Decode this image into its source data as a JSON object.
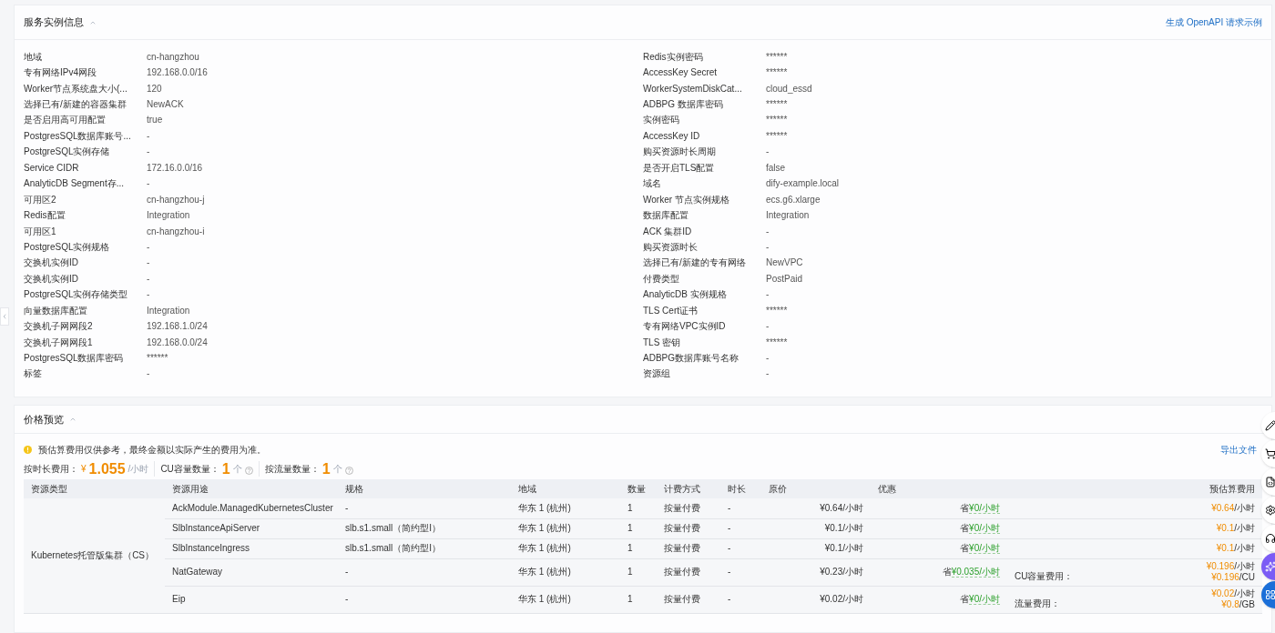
{
  "instance_section": {
    "title": "服务实例信息",
    "expanded": true,
    "link": "生成 OpenAPI 请求示例",
    "left_fields": [
      {
        "label": "地域",
        "value": "cn-hangzhou"
      },
      {
        "label": "专有网络IPv4网段",
        "value": "192.168.0.0/16"
      },
      {
        "label": "Worker节点系统盘大小(...",
        "value": "120"
      },
      {
        "label": "选择已有/新建的容器集群",
        "value": "NewACK"
      },
      {
        "label": "是否启用高可用配置",
        "value": "true"
      },
      {
        "label": "PostgresSQL数据库账号...",
        "value": "-"
      },
      {
        "label": "PostgreSQL实例存储",
        "value": "-"
      },
      {
        "label": "Service CIDR",
        "value": "172.16.0.0/16"
      },
      {
        "label": "AnalyticDB Segment存...",
        "value": "-"
      },
      {
        "label": "可用区2",
        "value": "cn-hangzhou-j"
      },
      {
        "label": "Redis配置",
        "value": "Integration"
      },
      {
        "label": "可用区1",
        "value": "cn-hangzhou-i"
      },
      {
        "label": "PostgreSQL实例规格",
        "value": "-"
      },
      {
        "label": "交换机实例ID",
        "value": "-"
      },
      {
        "label": "交换机实例ID",
        "value": "-"
      },
      {
        "label": "PostgreSQL实例存储类型",
        "value": "-"
      },
      {
        "label": "向量数据库配置",
        "value": "Integration"
      },
      {
        "label": "交换机子网网段2",
        "value": "192.168.1.0/24"
      },
      {
        "label": "交换机子网网段1",
        "value": "192.168.0.0/24"
      },
      {
        "label": "PostgresSQL数据库密码",
        "value": "******"
      },
      {
        "label": "标签",
        "value": "-"
      }
    ],
    "right_fields": [
      {
        "label": "Redis实例密码",
        "value": "******"
      },
      {
        "label": "AccessKey Secret",
        "value": "******"
      },
      {
        "label": "WorkerSystemDiskCat...",
        "value": "cloud_essd"
      },
      {
        "label": "ADBPG 数据库密码",
        "value": "******"
      },
      {
        "label": "实例密码",
        "value": "******"
      },
      {
        "label": "AccessKey ID",
        "value": "******"
      },
      {
        "label": "购买资源时长周期",
        "value": "-"
      },
      {
        "label": "是否开启TLS配置",
        "value": "false"
      },
      {
        "label": "域名",
        "value": "dify-example.local"
      },
      {
        "label": "Worker 节点实例规格",
        "value": "ecs.g6.xlarge"
      },
      {
        "label": "数据库配置",
        "value": "Integration"
      },
      {
        "label": "ACK 集群ID",
        "value": "-"
      },
      {
        "label": "购买资源时长",
        "value": "-"
      },
      {
        "label": "选择已有/新建的专有网络",
        "value": "NewVPC"
      },
      {
        "label": "付费类型",
        "value": "PostPaid"
      },
      {
        "label": "AnalyticDB 实例规格",
        "value": "-"
      },
      {
        "label": "TLS Cert证书",
        "value": "******"
      },
      {
        "label": "专有网络VPC实例ID",
        "value": "-"
      },
      {
        "label": "TLS 密钥",
        "value": "******"
      },
      {
        "label": "ADBPG数据库账号名称",
        "value": "-"
      },
      {
        "label": "资源组",
        "value": "-"
      }
    ]
  },
  "price_section": {
    "title": "价格预览",
    "expanded": true,
    "notice": "预估算费用仅供参考，最终金额以实际产生的费用为准。",
    "export_link": "导出文件",
    "summary": [
      {
        "label": "按时长费用：",
        "currency": "¥",
        "amount": "1.055",
        "unit": "/小时",
        "help": false
      },
      {
        "label": "CU容量数量：",
        "amount": "1",
        "unit": "个",
        "help": true
      },
      {
        "label": "按流量数量：",
        "amount": "1",
        "unit": "个",
        "help": true
      }
    ],
    "columns": [
      "资源类型",
      "资源用途",
      "规格",
      "地域",
      "数量",
      "计费方式",
      "时长",
      "原价",
      "优惠",
      "预估算费用"
    ],
    "resource_type": "Kubernetes托管版集群（CS）",
    "rows": [
      {
        "usage": "AckModule.ManagedKubernetesCluster",
        "spec": "-",
        "region": "华东 1 (杭州)",
        "quantity": "1",
        "billing": "按量付费",
        "duration": "-",
        "price": "¥0.64/小时",
        "discount_prefix": "省",
        "discount": "¥0/小时",
        "extra": "",
        "estimate": [
          {
            "amount": "¥0.64",
            "unit": "/小时"
          }
        ]
      },
      {
        "usage": "SlbInstanceApiServer",
        "spec": "slb.s1.small（简约型I）",
        "region": "华东 1 (杭州)",
        "quantity": "1",
        "billing": "按量付费",
        "duration": "-",
        "price": "¥0.1/小时",
        "discount_prefix": "省",
        "discount": "¥0/小时",
        "extra": "",
        "estimate": [
          {
            "amount": "¥0.1",
            "unit": "/小时"
          }
        ]
      },
      {
        "usage": "SlbInstanceIngress",
        "spec": "slb.s1.small（简约型I）",
        "region": "华东 1 (杭州)",
        "quantity": "1",
        "billing": "按量付费",
        "duration": "-",
        "price": "¥0.1/小时",
        "discount_prefix": "省",
        "discount": "¥0/小时",
        "extra": "",
        "estimate": [
          {
            "amount": "¥0.1",
            "unit": "/小时"
          }
        ]
      },
      {
        "usage": "NatGateway",
        "spec": "-",
        "region": "华东 1 (杭州)",
        "quantity": "1",
        "billing": "按量付费",
        "duration": "-",
        "price": "¥0.23/小时",
        "discount_prefix": "省",
        "discount": "¥0.035/小时",
        "extra": "CU容量费用：",
        "estimate": [
          {
            "amount": "¥0.196",
            "unit": "/小时"
          },
          {
            "amount": "¥0.196",
            "unit": "/CU"
          }
        ]
      },
      {
        "usage": "Eip",
        "spec": "-",
        "region": "华东 1 (杭州)",
        "quantity": "1",
        "billing": "按量付费",
        "duration": "-",
        "price": "¥0.02/小时",
        "discount_prefix": "省",
        "discount": "¥0/小时",
        "extra": "流量费用：",
        "estimate": [
          {
            "amount": "¥0.02",
            "unit": "/小时"
          },
          {
            "amount": "¥0.8",
            "unit": "/GB"
          }
        ]
      }
    ]
  },
  "floating_tools": [
    {
      "kind": "edit"
    },
    {
      "kind": "cart"
    },
    {
      "kind": "document"
    },
    {
      "kind": "settings"
    },
    {
      "kind": "support"
    },
    {
      "kind": "assistant"
    },
    {
      "kind": "apps"
    }
  ]
}
